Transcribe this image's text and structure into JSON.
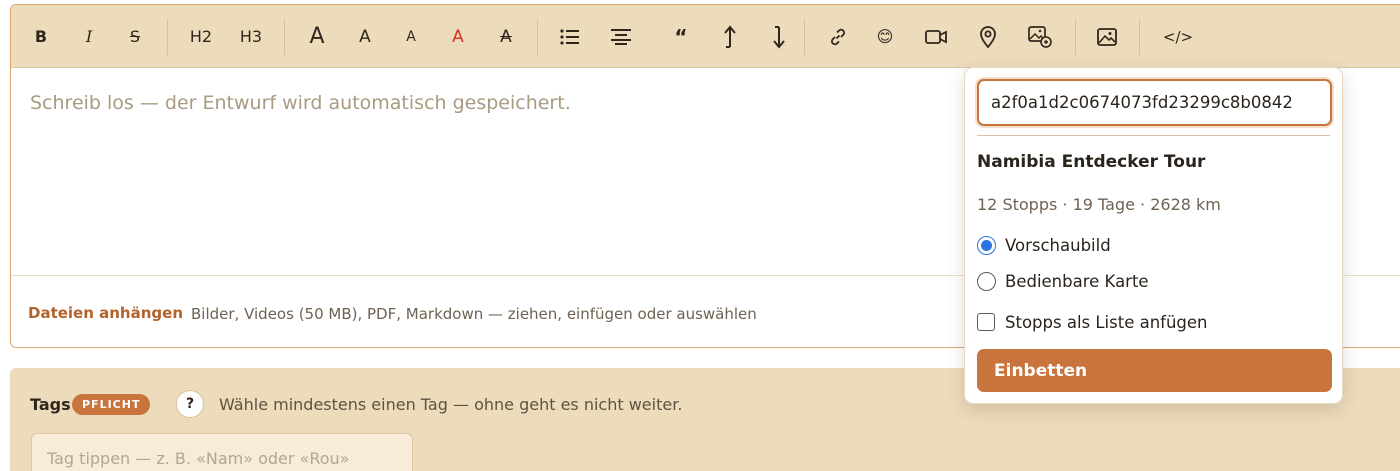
{
  "toolbar": {
    "bold": "B",
    "italic": "I",
    "strike": "S",
    "h2": "H2",
    "h3": "H3",
    "font_large": "A",
    "font_medium": "A",
    "font_small": "A",
    "font_color": "A",
    "font_clear": "A",
    "quote": "“",
    "code": "</>",
    "emoji": "😊",
    "font_color_value": "#d93025",
    "icons": [
      "bullet-list",
      "align-center",
      "arrow-up",
      "arrow-down",
      "link",
      "emoji",
      "video",
      "map-pin",
      "route-image",
      "image"
    ]
  },
  "editor": {
    "placeholder": "Schreib los — der Entwurf wird automatisch gespeichert."
  },
  "attachments": {
    "label": "Dateien anhängen",
    "hint": "Bilder, Videos (50 MB), PDF, Markdown — ziehen, einfügen oder auswählen"
  },
  "tags": {
    "label": "Tags",
    "required_badge": "PFLICHT",
    "help_icon": "?",
    "hint": "Wähle mindestens einen Tag — ohne geht es nicht weiter.",
    "input_placeholder": "Tag tippen — z. B. «Nam» oder «Rou»"
  },
  "embed_popover": {
    "input_value": "a2f0a1d2c0674073fd23299c8b0842",
    "title": "Namibia Entdecker Tour",
    "meta": "12 Stopps · 19 Tage · 2628 km",
    "option_preview": "Vorschaubild",
    "option_map": "Bedienbare Karte",
    "option_list": "Stopps als Liste anfügen",
    "selected": "Vorschaubild",
    "button": "Einbetten"
  },
  "colors": {
    "accent": "#c8743c",
    "toolbar_bg": "#ecdcbc",
    "radio_selected": "#2d73e0"
  }
}
